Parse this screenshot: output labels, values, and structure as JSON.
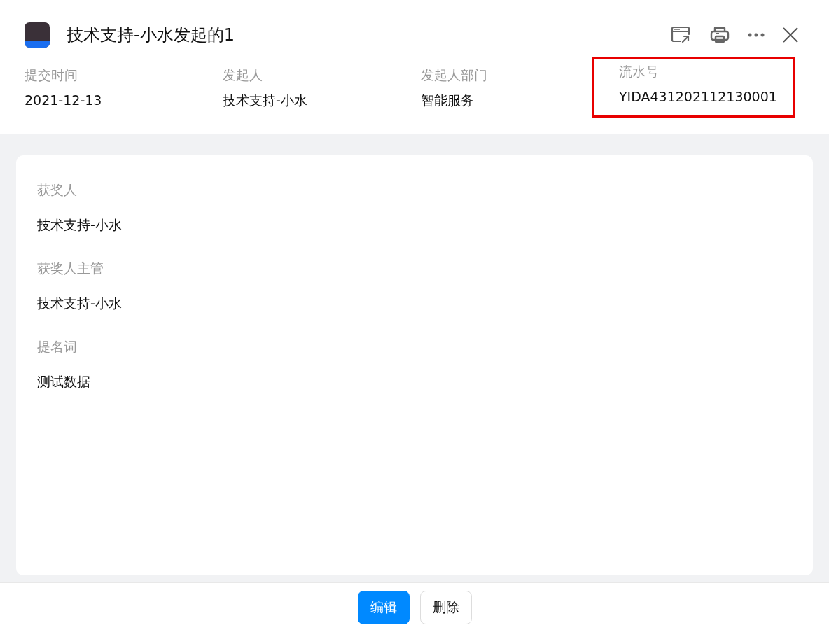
{
  "header": {
    "title": "技术支持-小水发起的1"
  },
  "meta": [
    {
      "label": "提交时间",
      "value": "2021-12-13",
      "highlighted": false
    },
    {
      "label": "发起人",
      "value": "技术支持-小水",
      "highlighted": false
    },
    {
      "label": "发起人部门",
      "value": "智能服务",
      "highlighted": false
    },
    {
      "label": "流水号",
      "value": "YIDA431202112130001",
      "highlighted": true
    }
  ],
  "fields": [
    {
      "label": "获奖人",
      "value": "技术支持-小水"
    },
    {
      "label": "获奖人主管",
      "value": "技术支持-小水"
    },
    {
      "label": "提名词",
      "value": "测试数据"
    }
  ],
  "buttons": [
    {
      "label": "编辑",
      "kind": "primary"
    },
    {
      "label": "删除",
      "kind": "default"
    }
  ]
}
